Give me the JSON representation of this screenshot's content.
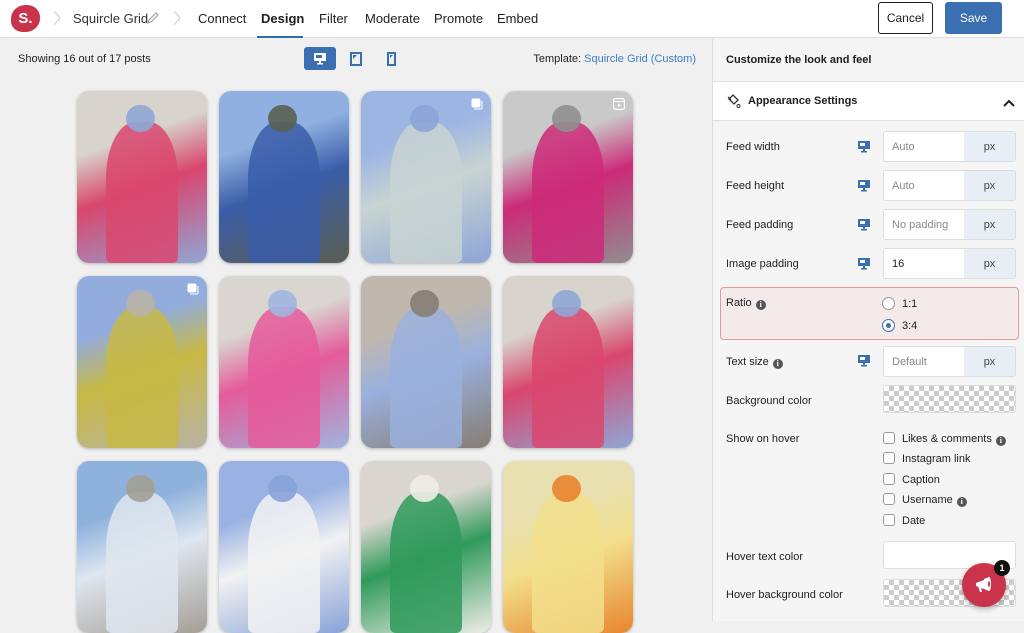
{
  "brand": {
    "logo_text": "S.",
    "accent": "#c9344b",
    "primary": "#3a6fb0"
  },
  "header": {
    "feed_name": "Squircle Grid",
    "nav": [
      {
        "label": "Connect",
        "active": false
      },
      {
        "label": "Design",
        "active": true
      },
      {
        "label": "Filter",
        "active": false
      },
      {
        "label": "Moderate",
        "active": false
      },
      {
        "label": "Promote",
        "active": false
      },
      {
        "label": "Embed",
        "active": false
      }
    ],
    "cancel_label": "Cancel",
    "save_label": "Save"
  },
  "preview": {
    "showing_text": "Showing 16 out of 17 posts",
    "devices": [
      {
        "name": "desktop",
        "active": true
      },
      {
        "name": "tablet",
        "active": false
      },
      {
        "name": "mobile",
        "active": false
      }
    ],
    "template_label": "Template:",
    "template_value": "Squircle Grid (Custom)",
    "posts": [
      {
        "desc": "Two women with braids in pink and blue blazers",
        "colors": [
          "#d8d3cc",
          "#d9466e",
          "#8fa7d6"
        ],
        "badge": null
      },
      {
        "desc": "Woman in blue suit on stairs",
        "colors": [
          "#8fb0e0",
          "#3a5da8",
          "#5a5f52"
        ],
        "badge": null
      },
      {
        "desc": "Lavender blazer with turquoise necklace",
        "colors": [
          "#9db5e3",
          "#c8d4d2",
          "#8ca4d8"
        ],
        "badge": "carousel"
      },
      {
        "desc": "Woman in pink suit leaning",
        "colors": [
          "#c9c9c9",
          "#cc2a78",
          "#8f8f8f"
        ],
        "badge": "reel"
      },
      {
        "desc": "Lavender blazer with yellow bag",
        "colors": [
          "#93acde",
          "#c7b944",
          "#b8b2a6"
        ],
        "badge": "carousel"
      },
      {
        "desc": "Two women in blue and pink suits with bags",
        "colors": [
          "#d9d5d0",
          "#e55a9a",
          "#9fb5df"
        ],
        "badge": null
      },
      {
        "desc": "Woman in lavender suit against stone wall",
        "colors": [
          "#c0b8ae",
          "#9ab0dd",
          "#857d72"
        ],
        "badge": null
      },
      {
        "desc": "Two women with braids in pink and blue blazers",
        "colors": [
          "#d8d3cc",
          "#d9466e",
          "#8fa7d6"
        ],
        "badge": null
      },
      {
        "desc": "Woman sitting on wall under cloudy sky",
        "colors": [
          "#8fb2dd",
          "#dfe6ef",
          "#a39e95"
        ],
        "badge": null
      },
      {
        "desc": "Hand in lavender trouser pocket with blue ring",
        "colors": [
          "#9ab2e3",
          "#f2f2f2",
          "#87a2d8"
        ],
        "badge": null
      },
      {
        "desc": "Two people in green and white blazers",
        "colors": [
          "#d9d6d0",
          "#2f9a5a",
          "#f0ede8"
        ],
        "badge": null
      },
      {
        "desc": "Woman in yellow suit with orange chairs",
        "colors": [
          "#e8e0b0",
          "#f2df8c",
          "#e8852e"
        ],
        "badge": null
      }
    ]
  },
  "panel": {
    "title": "Customize the look and feel",
    "section_title": "Appearance Settings",
    "fields": {
      "feed_width": {
        "label": "Feed width",
        "value": "",
        "placeholder": "Auto",
        "unit": "px"
      },
      "feed_height": {
        "label": "Feed height",
        "value": "",
        "placeholder": "Auto",
        "unit": "px"
      },
      "feed_padding": {
        "label": "Feed padding",
        "value": "",
        "placeholder": "No padding",
        "unit": "px"
      },
      "image_padding": {
        "label": "Image padding",
        "value": "16",
        "placeholder": "",
        "unit": "px"
      },
      "text_size": {
        "label": "Text size",
        "value": "",
        "placeholder": "Default",
        "unit": "px"
      }
    },
    "ratio": {
      "label": "Ratio",
      "options": [
        {
          "label": "1:1",
          "checked": false
        },
        {
          "label": "3:4",
          "checked": true
        }
      ]
    },
    "background_color_label": "Background color",
    "show_on_hover": {
      "label": "Show on hover",
      "options": [
        {
          "label": "Likes & comments",
          "checked": false,
          "info": true
        },
        {
          "label": "Instagram link",
          "checked": false,
          "info": false
        },
        {
          "label": "Caption",
          "checked": false,
          "info": false
        },
        {
          "label": "Username",
          "checked": false,
          "info": true
        },
        {
          "label": "Date",
          "checked": false,
          "info": false
        }
      ]
    },
    "hover_text_color_label": "Hover text color",
    "hover_bg_color_label": "Hover background color"
  },
  "fab": {
    "badge_count": "1"
  }
}
